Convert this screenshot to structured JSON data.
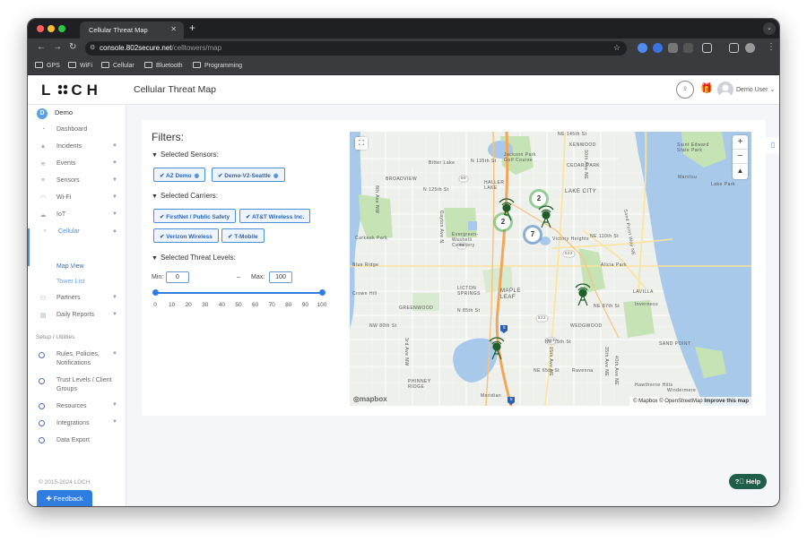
{
  "browser": {
    "tab_title": "Cellular Threat Map",
    "url_host": "console.802secure.net",
    "url_path": "/celltowers/map",
    "bookmarks": [
      "GPS",
      "WiFi",
      "Cellular",
      "Bluetooth",
      "Programming"
    ]
  },
  "header": {
    "logo_left": "L",
    "logo_right": "CH",
    "page_title": "Cellular Threat Map",
    "user": "Demo User"
  },
  "sidebar": {
    "org_initial": "D",
    "org_name": "Demo",
    "items": [
      {
        "label": "Dashboard"
      },
      {
        "label": "Incidents"
      },
      {
        "label": "Events"
      },
      {
        "label": "Sensors"
      },
      {
        "label": "Wi-Fi"
      },
      {
        "label": "IoT"
      },
      {
        "label": "Cellular"
      },
      {
        "label": "Partners"
      },
      {
        "label": "Daily Reports"
      }
    ],
    "cellular_sub": [
      "Map View",
      "Tower List"
    ],
    "setup_label": "Setup / Utilities",
    "setup_items": [
      {
        "label": "Rules, Policies, Notifications"
      },
      {
        "label": "Trust Levels / Client Groups"
      },
      {
        "label": "Resources"
      },
      {
        "label": "Integrations"
      },
      {
        "label": "Data Export"
      }
    ],
    "copyright": "© 2015-2024 LOCH",
    "feedback": "Feedback"
  },
  "filters": {
    "title": "Filters:",
    "sensors_label": "Selected Sensors:",
    "sensors": [
      "AZ Demo",
      "Demo-V2-Seattle"
    ],
    "carriers_label": "Selected Carriers:",
    "carriers": [
      "FirstNet / Public Safety",
      "AT&T Wireless Inc.",
      "Verizon Wireless",
      "T-Mobile"
    ],
    "threat_label": "Selected Threat Levels:",
    "min_label": "Min:",
    "min_value": "0",
    "dash": "–",
    "max_label": "Max:",
    "max_value": "100",
    "ticks": [
      "0",
      "10",
      "20",
      "30",
      "40",
      "50",
      "60",
      "70",
      "80",
      "90",
      "100"
    ]
  },
  "map": {
    "attribution": "© Mapbox © OpenStreetMap",
    "improve": "Improve this map",
    "logo": "mapbox",
    "clusters": [
      "2",
      "2",
      "7"
    ],
    "labels": {
      "ne145": "NE 145th St",
      "kenwood": "KENWOOD",
      "jackson": "Jackson Park Golf Course",
      "bitter": "Bitter Lake",
      "n135": "N 135th St",
      "broadview": "BROADVIEW",
      "haller": "HALLER LAKE",
      "cedar": "CEDAR PARK",
      "lakecity": "LAKE CITY",
      "stedward": "Saint Edward State Park",
      "manitou": "Manitou",
      "lakepark": "Lake Park",
      "n125": "N 125th St",
      "dayton": "Dayton Ave N",
      "evergreen": "Evergreen-Washelli Cemetery",
      "carkeek": "Carkeek Park",
      "victory": "Victory Heights",
      "ne110": "NE 110th St",
      "blueridge": "Blue Ridge",
      "alicia": "Alicia Park",
      "crownhill": "Crown Hill",
      "licton": "LICTON SPRINGS",
      "maple": "MAPLE LEAF",
      "greenwood": "GREENWOOD",
      "n85": "N 85th St",
      "ne87": "NE 87th St",
      "inverness": "Inverness",
      "lavilla": "LAVILLA",
      "nw80": "NW 80th St",
      "wedgwood": "WEDGWOOD",
      "ne75": "NE 75th St",
      "sandpoint": "SAND POINT",
      "ne65": "NE 65th St",
      "ravenna": "Ravenna",
      "phinney": "PHINNEY RIDGE",
      "hawthorne": "Hawthorne Hills",
      "windermere": "Windermere",
      "meridian": "Meridian",
      "ave15": "15th Ave NE",
      "ave35": "35th Ave NE",
      "ave40": "40th Ave NE",
      "ave30": "30th Ave NE",
      "ave3": "3rd Ave NW",
      "ave8": "8th Ave NW",
      "sandpointway": "Sand Point Way NE",
      "i5": "5",
      "r99": "99",
      "r522": "522",
      "r513": "513"
    }
  },
  "help": "Help",
  "colors": {
    "accent": "#2f7de1",
    "tower": "#1f5e29",
    "water": "#a9c9ea",
    "park": "#c6e3b5",
    "highway": "#f2a65a"
  }
}
